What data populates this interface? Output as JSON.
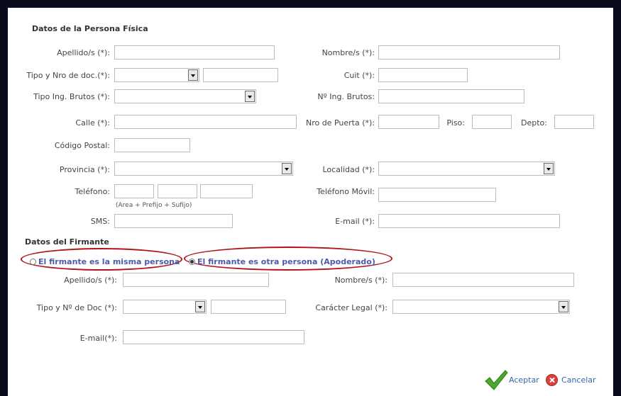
{
  "persona": {
    "title": "Datos de la Persona Física",
    "apellido_label": "Apellido/s (*):",
    "nombre_label": "Nombre/s (*):",
    "tipo_doc_label": "Tipo y Nro de doc.(*):",
    "cuit_label": "Cuit (*):",
    "tipo_ib_label": "Tipo Ing. Brutos (*):",
    "nro_ib_label": "Nº Ing. Brutos:",
    "calle_label": "Calle (*):",
    "nro_puerta_label": "Nro de Puerta (*):",
    "piso_label": "Piso:",
    "depto_label": "Depto:",
    "cp_label": "Código Postal:",
    "provincia_label": "Provincia (*):",
    "localidad_label": "Localidad (*):",
    "telefono_label": "Teléfono:",
    "telefono_hint": "(Area + Prefijo + Sufijo)",
    "telefono_movil_label": "Teléfono Móvil:",
    "sms_label": "SMS:",
    "email_label": "E-mail (*):"
  },
  "firmante": {
    "title": "Datos del Firmante",
    "option_misma": "El firmante es la misma persona",
    "option_otra": "El firmante es otra persona (Apoderado)",
    "selected_option": "otra",
    "apellido_label": "Apellido/s (*):",
    "nombre_label": "Nombre/s (*):",
    "tipo_doc_label": "Tipo y Nº de Doc (*):",
    "caracter_label": "Carácter Legal (*):",
    "email_label": "E-mail(*):"
  },
  "actions": {
    "accept_label": "Aceptar",
    "cancel_label": "Cancelar"
  },
  "colors": {
    "frame": "#0b0b1e",
    "radio_text": "#4b5bab",
    "highlight_ellipse": "#b0141a",
    "link": "#3367b5",
    "check_icon": "#4aa82c",
    "cancel_icon": "#d9413b"
  },
  "icons": {
    "accept": "check-icon",
    "cancel": "cancel-icon"
  }
}
